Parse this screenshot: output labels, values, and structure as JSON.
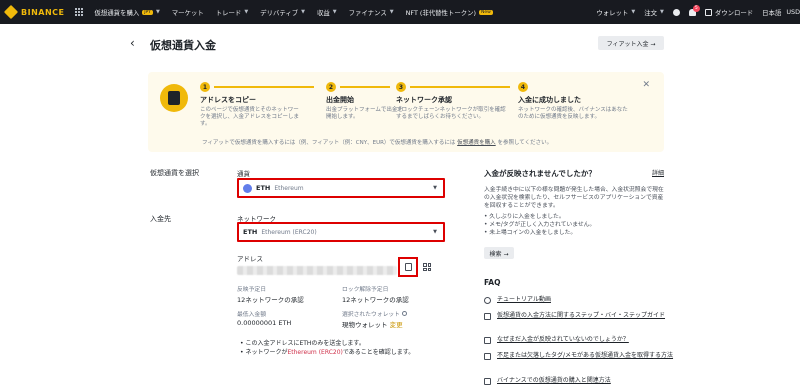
{
  "nav": {
    "logo": "BINANCE",
    "items": [
      {
        "label": "仮想通貨を購入",
        "badge": "JPY"
      },
      {
        "label": "マーケット"
      },
      {
        "label": "トレード"
      },
      {
        "label": "デリバティブ"
      },
      {
        "label": "収益"
      },
      {
        "label": "ファイナンス"
      },
      {
        "label": "NFT (非代替性トークン)",
        "badge": "New"
      }
    ],
    "right": {
      "wallet": "ウォレット",
      "orders": "注文",
      "notification_count": "5",
      "download": "ダウンロード",
      "lang": "日本語",
      "currency": "USD"
    }
  },
  "header": {
    "title": "仮想通貨入金",
    "fiat_button": "フィアット入金 →"
  },
  "steps": {
    "items": [
      {
        "num": "1",
        "title": "アドレスをコピー",
        "desc": "このページで仮想通貨とそのネットワークを選択し、入金アドレスをコピーします。"
      },
      {
        "num": "2",
        "title": "出金開始",
        "desc": "出金プラットフォームで出金を開始します。"
      },
      {
        "num": "3",
        "title": "ネットワーク承認",
        "desc": "ブロックチェーンネットワークが取引を確認するまでしばらくお待ちください。"
      },
      {
        "num": "4",
        "title": "入金に成功しました",
        "desc": "ネットワークの確認後、バイナンスはあなたのために仮想通貨を反映します。"
      }
    ],
    "note": "フィアットで仮想通貨を購入するには（例、フィアット（例：CNY、EUR）で仮想通貨を購入するには",
    "note_link": "仮想通貨を購入",
    "note_tail": "を参照してください。"
  },
  "form": {
    "select_coin_label": "仮想通貨を選択",
    "coin_field_label": "通貨",
    "coin_symbol": "ETH",
    "coin_name": "Ethereum",
    "deposit_to_label": "入金先",
    "network_field_label": "ネットワーク",
    "network_symbol": "ETH",
    "network_name": "Ethereum (ERC20)",
    "address_label": "アドレス"
  },
  "details": {
    "expected_arrival_label": "反映予定日",
    "expected_arrival_value": "12ネットワークの承認",
    "unlock_label": "ロック解除予定日",
    "unlock_value": "12ネットワークの承認",
    "min_deposit_label": "最低入金額",
    "min_deposit_value": "0.00000001 ETH",
    "wallet_label": "選択されたウォレット",
    "wallet_value": "現物ウォレット",
    "wallet_change": "変更"
  },
  "notes": {
    "n1": "この入金アドレスにETHのみを送金します。",
    "n2_pre": "ネットワークが",
    "n2_link": "Ethereum (ERC20)",
    "n2_post": "であることを確認します。"
  },
  "help": {
    "title": "入金が反映されませんでしたか？",
    "detail_link": "詳細",
    "desc": "入金手続き中に以下の様な問題が発生した場合、入金状況照会で現在の入金状況を検索したり、セルフサービスのアプリケーションで資産を回収することができます。",
    "list": [
      "久しぶりに入金をしました。",
      "メモ/タグが正しく入力されていません。",
      "未上場コインの入金をしました。"
    ],
    "search_button": "検索 →"
  },
  "faq": {
    "title": "FAQ",
    "items": [
      "チュートリアル動画",
      "仮想通貨の入金方法に関するステップ・バイ・ステップガイド",
      "なぜまだ入金が反映されていないのでしょうか？",
      "不足または欠落したタグ/メモがある仮想通貨入金を取得する方法",
      "バイナンスでの仮想通貨の購入と関連方法"
    ]
  }
}
